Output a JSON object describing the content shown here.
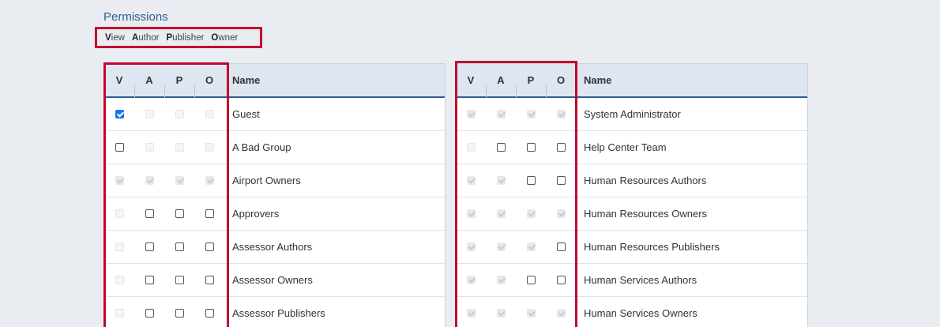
{
  "title": "Permissions",
  "legend": [
    {
      "key": "V",
      "rest": "iew"
    },
    {
      "key": "A",
      "rest": "uthor"
    },
    {
      "key": "P",
      "rest": "ublisher"
    },
    {
      "key": "O",
      "rest": "wner"
    }
  ],
  "columns": {
    "v": "V",
    "a": "A",
    "p": "P",
    "o": "O",
    "name": "Name"
  },
  "left_rows": [
    {
      "name": "Guest",
      "v": {
        "checked": true,
        "disabled": false
      },
      "a": {
        "checked": false,
        "disabled": true
      },
      "p": {
        "checked": false,
        "disabled": true
      },
      "o": {
        "checked": false,
        "disabled": true
      }
    },
    {
      "name": "A Bad Group",
      "v": {
        "checked": false,
        "disabled": false
      },
      "a": {
        "checked": false,
        "disabled": true
      },
      "p": {
        "checked": false,
        "disabled": true
      },
      "o": {
        "checked": false,
        "disabled": true
      }
    },
    {
      "name": "Airport Owners",
      "v": {
        "checked": true,
        "disabled": true
      },
      "a": {
        "checked": true,
        "disabled": true
      },
      "p": {
        "checked": true,
        "disabled": true
      },
      "o": {
        "checked": true,
        "disabled": true
      }
    },
    {
      "name": "Approvers",
      "v": {
        "checked": false,
        "disabled": true
      },
      "a": {
        "checked": false,
        "disabled": false
      },
      "p": {
        "checked": false,
        "disabled": false
      },
      "o": {
        "checked": false,
        "disabled": false
      }
    },
    {
      "name": "Assessor Authors",
      "v": {
        "checked": false,
        "disabled": true
      },
      "a": {
        "checked": false,
        "disabled": false
      },
      "p": {
        "checked": false,
        "disabled": false
      },
      "o": {
        "checked": false,
        "disabled": false
      }
    },
    {
      "name": "Assessor Owners",
      "v": {
        "checked": false,
        "disabled": true
      },
      "a": {
        "checked": false,
        "disabled": false
      },
      "p": {
        "checked": false,
        "disabled": false
      },
      "o": {
        "checked": false,
        "disabled": false
      }
    },
    {
      "name": "Assessor Publishers",
      "v": {
        "checked": false,
        "disabled": true
      },
      "a": {
        "checked": false,
        "disabled": false
      },
      "p": {
        "checked": false,
        "disabled": false
      },
      "o": {
        "checked": false,
        "disabled": false
      }
    }
  ],
  "right_rows": [
    {
      "name": "System Administrator",
      "v": {
        "checked": true,
        "disabled": true
      },
      "a": {
        "checked": true,
        "disabled": true
      },
      "p": {
        "checked": true,
        "disabled": true
      },
      "o": {
        "checked": true,
        "disabled": true
      }
    },
    {
      "name": "Help Center Team",
      "v": {
        "checked": false,
        "disabled": true
      },
      "a": {
        "checked": false,
        "disabled": false
      },
      "p": {
        "checked": false,
        "disabled": false
      },
      "o": {
        "checked": false,
        "disabled": false
      }
    },
    {
      "name": "Human Resources Authors",
      "v": {
        "checked": true,
        "disabled": true
      },
      "a": {
        "checked": true,
        "disabled": true
      },
      "p": {
        "checked": false,
        "disabled": false
      },
      "o": {
        "checked": false,
        "disabled": false
      }
    },
    {
      "name": "Human Resources Owners",
      "v": {
        "checked": true,
        "disabled": true
      },
      "a": {
        "checked": true,
        "disabled": true
      },
      "p": {
        "checked": true,
        "disabled": true
      },
      "o": {
        "checked": true,
        "disabled": true
      }
    },
    {
      "name": "Human Resources Publishers",
      "v": {
        "checked": true,
        "disabled": true
      },
      "a": {
        "checked": true,
        "disabled": true
      },
      "p": {
        "checked": true,
        "disabled": true
      },
      "o": {
        "checked": false,
        "disabled": false
      }
    },
    {
      "name": "Human Services Authors",
      "v": {
        "checked": true,
        "disabled": true
      },
      "a": {
        "checked": true,
        "disabled": true
      },
      "p": {
        "checked": false,
        "disabled": false
      },
      "o": {
        "checked": false,
        "disabled": false
      }
    },
    {
      "name": "Human Services Owners",
      "v": {
        "checked": true,
        "disabled": true
      },
      "a": {
        "checked": true,
        "disabled": true
      },
      "p": {
        "checked": true,
        "disabled": true
      },
      "o": {
        "checked": true,
        "disabled": true
      }
    }
  ]
}
